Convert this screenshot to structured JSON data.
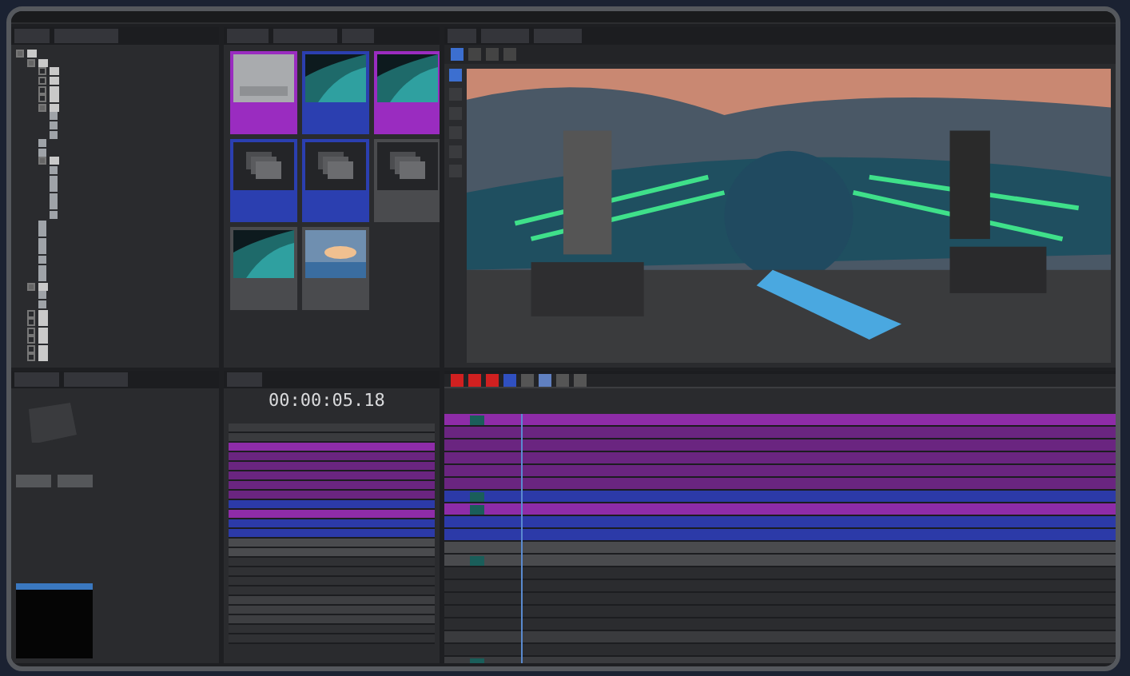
{
  "project_tree": {
    "nodes": [
      {
        "kind": "folder",
        "expanded": true,
        "children": [
          {
            "kind": "folder",
            "expanded": true,
            "children": [
              {
                "kind": "folder",
                "expanded": false
              },
              {
                "kind": "folder",
                "expanded": false
              },
              {
                "kind": "folder",
                "expanded": false
              },
              {
                "kind": "folder",
                "expanded": false
              },
              {
                "kind": "folder",
                "expanded": true,
                "children": [
                  {
                    "kind": "file"
                  },
                  {
                    "kind": "file"
                  },
                  {
                    "kind": "file"
                  }
                ]
              },
              {
                "kind": "file"
              },
              {
                "kind": "file"
              },
              {
                "kind": "folder",
                "expanded": true,
                "children": [
                  {
                    "kind": "file"
                  },
                  {
                    "kind": "file"
                  },
                  {
                    "kind": "file"
                  },
                  {
                    "kind": "file"
                  },
                  {
                    "kind": "file"
                  },
                  {
                    "kind": "file"
                  }
                ]
              },
              {
                "kind": "file"
              },
              {
                "kind": "file"
              },
              {
                "kind": "file"
              },
              {
                "kind": "file"
              },
              {
                "kind": "file"
              },
              {
                "kind": "file"
              },
              {
                "kind": "file"
              }
            ]
          },
          {
            "kind": "folder",
            "expanded": true,
            "children": [
              {
                "kind": "file"
              },
              {
                "kind": "file"
              }
            ]
          },
          {
            "kind": "folder",
            "expanded": false
          },
          {
            "kind": "folder",
            "expanded": false
          },
          {
            "kind": "folder",
            "expanded": false
          },
          {
            "kind": "folder",
            "expanded": false
          },
          {
            "kind": "folder",
            "expanded": false
          },
          {
            "kind": "folder",
            "expanded": false
          }
        ]
      }
    ]
  },
  "media_pool": {
    "items": [
      {
        "kind": "texture",
        "color": "#9a2cc0"
      },
      {
        "kind": "picture",
        "color": "#2b3fb0"
      },
      {
        "kind": "picture",
        "color": "#9a2cc0"
      },
      {
        "kind": "stack",
        "color": "#2b3fb0"
      },
      {
        "kind": "stack",
        "color": "#2b3fb0"
      },
      {
        "kind": "stack",
        "color": "#4a4b4e"
      },
      {
        "kind": "picture",
        "color": "#4a4b4e"
      },
      {
        "kind": "sky",
        "color": "#4a4b4e"
      }
    ]
  },
  "viewport": {
    "kind": "picture"
  },
  "sequence": {
    "timecode": "00:00:05.18",
    "tracks": [
      {
        "color": "#3a3b3e"
      },
      {
        "color": "#3a3b3e"
      },
      {
        "color": "#8e2ca8"
      },
      {
        "color": "#6a2580"
      },
      {
        "color": "#6a2580"
      },
      {
        "color": "#6a2580"
      },
      {
        "color": "#6a2580"
      },
      {
        "color": "#6a2580"
      },
      {
        "color": "#2c3aa8"
      },
      {
        "color": "#8e2ca8"
      },
      {
        "color": "#2c3aa8"
      },
      {
        "color": "#2c3aa8"
      },
      {
        "color": "#4a4b4e"
      },
      {
        "color": "#4a4b4e"
      },
      {
        "color": "#303134"
      },
      {
        "color": "#303134"
      },
      {
        "color": "#303134"
      },
      {
        "color": "#303134"
      },
      {
        "color": "#3e3f42"
      },
      {
        "color": "#3e3f42"
      },
      {
        "color": "#3e3f42"
      },
      {
        "color": "#303134"
      },
      {
        "color": "#303134"
      }
    ]
  },
  "timeline": {
    "tracks": [
      {
        "color": "#8e2ca8",
        "kind": "clip"
      },
      {
        "color": "#6a2580",
        "kind": "lane"
      },
      {
        "color": "#6a2580",
        "kind": "lane"
      },
      {
        "color": "#6a2580",
        "kind": "lane"
      },
      {
        "color": "#6a2580",
        "kind": "lane"
      },
      {
        "color": "#6a2580",
        "kind": "lane"
      },
      {
        "color": "#2c3aa8",
        "kind": "clip"
      },
      {
        "color": "#8e2ca8",
        "kind": "clip"
      },
      {
        "color": "#2c3aa8",
        "kind": "lane"
      },
      {
        "color": "#2c3aa8",
        "kind": "lane"
      },
      {
        "color": "#4a4b4e",
        "kind": "lane"
      },
      {
        "color": "#4a4b4e",
        "kind": "clip"
      },
      {
        "color": "#2b2c2f",
        "kind": "lane"
      },
      {
        "color": "#2b2c2f",
        "kind": "lane"
      },
      {
        "color": "#2b2c2f",
        "kind": "lane"
      },
      {
        "color": "#2b2c2f",
        "kind": "lane"
      },
      {
        "color": "#2b2c2f",
        "kind": "lane"
      },
      {
        "color": "#3a3b3e",
        "kind": "lane"
      },
      {
        "color": "#2b2c2f",
        "kind": "lane"
      },
      {
        "color": "#3a3b3e",
        "kind": "clip"
      }
    ]
  }
}
